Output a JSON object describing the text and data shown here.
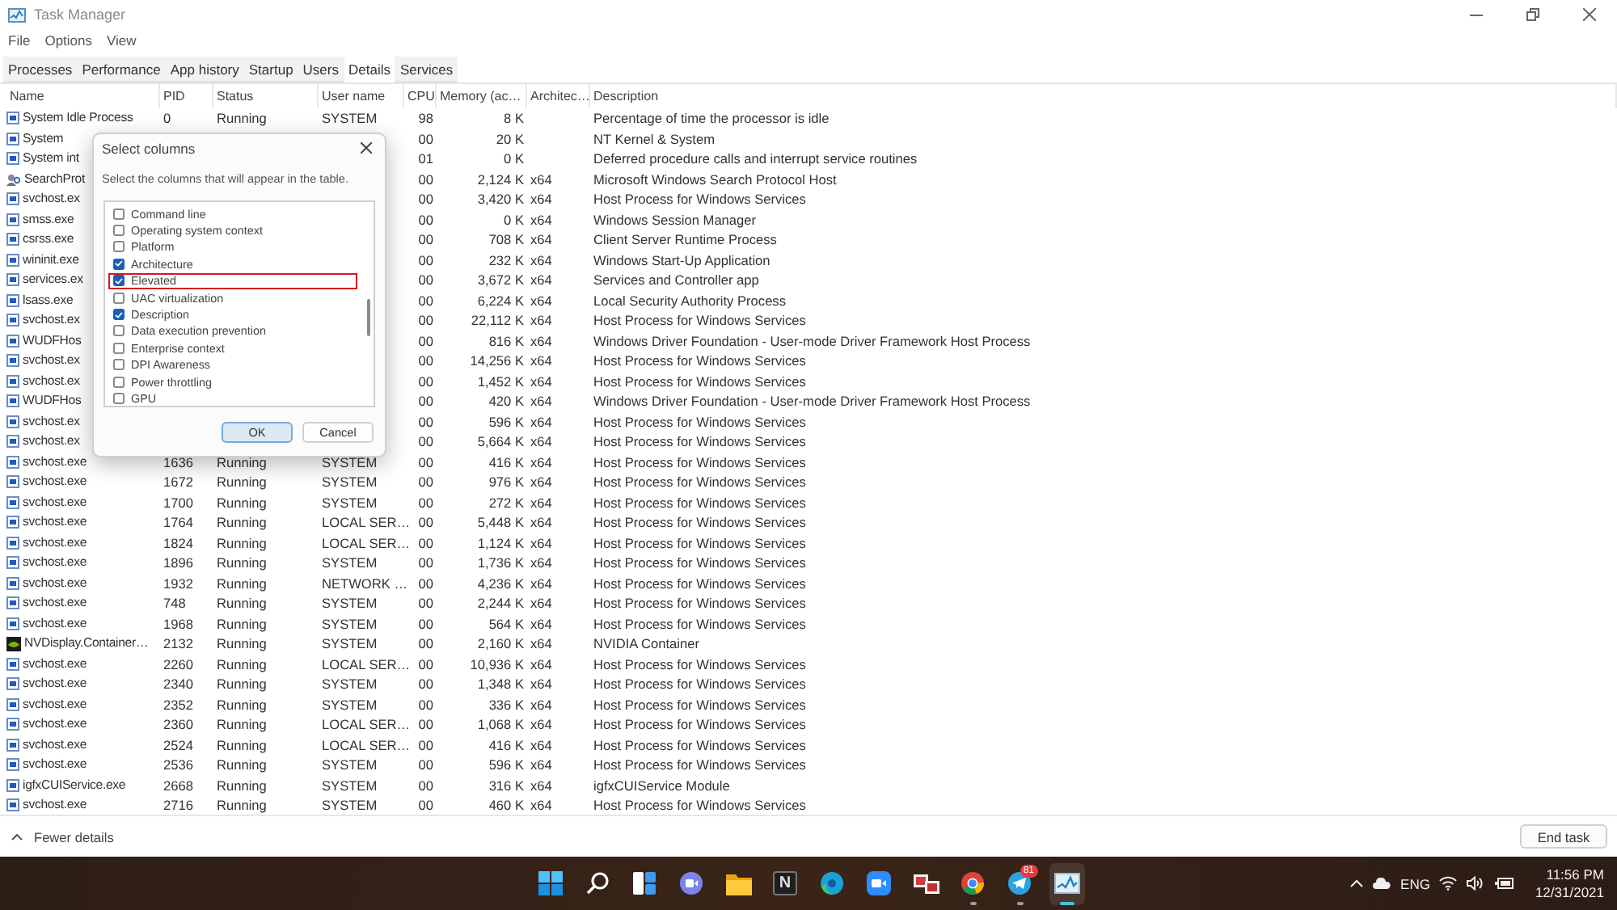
{
  "window": {
    "title": "Task Manager"
  },
  "menu": [
    "File",
    "Options",
    "View"
  ],
  "tabs": [
    {
      "label": "Processes",
      "selected": false
    },
    {
      "label": "Performance",
      "selected": false
    },
    {
      "label": "App history",
      "selected": false
    },
    {
      "label": "Startup",
      "selected": false
    },
    {
      "label": "Users",
      "selected": false
    },
    {
      "label": "Details",
      "selected": true
    },
    {
      "label": "Services",
      "selected": false
    }
  ],
  "table": {
    "columns": [
      "Name",
      "PID",
      "Status",
      "User name",
      "CPU",
      "Memory (ac…",
      "Architec…",
      "Description"
    ],
    "rows": [
      {
        "kind": "app",
        "name": "System Idle Process",
        "pid": "0",
        "status": "Running",
        "user": "SYSTEM",
        "cpu": "98",
        "memory": "8 K",
        "description": "Percentage of time the processor is idle"
      },
      {
        "kind": "app",
        "name": "System",
        "cpu": "00",
        "memory": "20 K",
        "description": "NT Kernel & System"
      },
      {
        "kind": "app",
        "name": "System int",
        "cpu": "01",
        "memory": "0 K",
        "description": "Deferred procedure calls and interrupt service routines"
      },
      {
        "kind": "search",
        "name": "SearchProt",
        "cpu": "00",
        "memory": "2,124 K",
        "arch": "x64",
        "description": "Microsoft Windows Search Protocol Host"
      },
      {
        "kind": "app",
        "name": "svchost.ex",
        "cpu": "00",
        "memory": "3,420 K",
        "arch": "x64",
        "description": "Host Process for Windows Services"
      },
      {
        "kind": "app",
        "name": "smss.exe",
        "cpu": "00",
        "memory": "0 K",
        "arch": "x64",
        "description": "Windows Session Manager"
      },
      {
        "kind": "app",
        "name": "csrss.exe",
        "cpu": "00",
        "memory": "708 K",
        "arch": "x64",
        "description": "Client Server Runtime Process"
      },
      {
        "kind": "app",
        "name": "wininit.exe",
        "cpu": "00",
        "memory": "232 K",
        "arch": "x64",
        "description": "Windows Start-Up Application"
      },
      {
        "kind": "app",
        "name": "services.ex",
        "cpu": "00",
        "memory": "3,672 K",
        "arch": "x64",
        "description": "Services and Controller app"
      },
      {
        "kind": "app",
        "name": "lsass.exe",
        "cpu": "00",
        "memory": "6,224 K",
        "arch": "x64",
        "description": "Local Security Authority Process"
      },
      {
        "kind": "app",
        "name": "svchost.ex",
        "cpu": "00",
        "memory": "22,112 K",
        "arch": "x64",
        "description": "Host Process for Windows Services"
      },
      {
        "kind": "app",
        "name": "WUDFHos",
        "cpu": "00",
        "memory": "816 K",
        "arch": "x64",
        "description": "Windows Driver Foundation - User-mode Driver Framework Host Process"
      },
      {
        "kind": "app",
        "name": "svchost.ex",
        "cpu": "00",
        "memory": "14,256 K",
        "arch": "x64",
        "description": "Host Process for Windows Services"
      },
      {
        "kind": "app",
        "name": "svchost.ex",
        "cpu": "00",
        "memory": "1,452 K",
        "arch": "x64",
        "description": "Host Process for Windows Services"
      },
      {
        "kind": "app",
        "name": "WUDFHos",
        "cpu": "00",
        "memory": "420 K",
        "arch": "x64",
        "description": "Windows Driver Foundation - User-mode Driver Framework Host Process"
      },
      {
        "kind": "app",
        "name": "svchost.ex",
        "cpu": "00",
        "memory": "596 K",
        "arch": "x64",
        "description": "Host Process for Windows Services"
      },
      {
        "kind": "app",
        "name": "svchost.ex",
        "cpu": "00",
        "memory": "5,664 K",
        "arch": "x64",
        "description": "Host Process for Windows Services"
      },
      {
        "kind": "app",
        "name": "svchost.exe",
        "pid": "1636",
        "status": "Running",
        "user": "SYSTEM",
        "cpu": "00",
        "memory": "416 K",
        "arch": "x64",
        "description": "Host Process for Windows Services"
      },
      {
        "kind": "app",
        "name": "svchost.exe",
        "pid": "1672",
        "status": "Running",
        "user": "SYSTEM",
        "cpu": "00",
        "memory": "976 K",
        "arch": "x64",
        "description": "Host Process for Windows Services"
      },
      {
        "kind": "app",
        "name": "svchost.exe",
        "pid": "1700",
        "status": "Running",
        "user": "SYSTEM",
        "cpu": "00",
        "memory": "272 K",
        "arch": "x64",
        "description": "Host Process for Windows Services"
      },
      {
        "kind": "app",
        "name": "svchost.exe",
        "pid": "1764",
        "status": "Running",
        "user": "LOCAL SER…",
        "cpu": "00",
        "memory": "5,448 K",
        "arch": "x64",
        "description": "Host Process for Windows Services"
      },
      {
        "kind": "app",
        "name": "svchost.exe",
        "pid": "1824",
        "status": "Running",
        "user": "LOCAL SER…",
        "cpu": "00",
        "memory": "1,124 K",
        "arch": "x64",
        "description": "Host Process for Windows Services"
      },
      {
        "kind": "app",
        "name": "svchost.exe",
        "pid": "1896",
        "status": "Running",
        "user": "SYSTEM",
        "cpu": "00",
        "memory": "1,736 K",
        "arch": "x64",
        "description": "Host Process for Windows Services"
      },
      {
        "kind": "app",
        "name": "svchost.exe",
        "pid": "1932",
        "status": "Running",
        "user": "NETWORK …",
        "cpu": "00",
        "memory": "4,236 K",
        "arch": "x64",
        "description": "Host Process for Windows Services"
      },
      {
        "kind": "app",
        "name": "svchost.exe",
        "pid": "748",
        "status": "Running",
        "user": "SYSTEM",
        "cpu": "00",
        "memory": "2,244 K",
        "arch": "x64",
        "description": "Host Process for Windows Services"
      },
      {
        "kind": "app",
        "name": "svchost.exe",
        "pid": "1968",
        "status": "Running",
        "user": "SYSTEM",
        "cpu": "00",
        "memory": "564 K",
        "arch": "x64",
        "description": "Host Process for Windows Services"
      },
      {
        "kind": "nvidia",
        "name": "NVDisplay.Container…",
        "pid": "2132",
        "status": "Running",
        "user": "SYSTEM",
        "cpu": "00",
        "memory": "2,160 K",
        "arch": "x64",
        "description": "NVIDIA Container"
      },
      {
        "kind": "app",
        "name": "svchost.exe",
        "pid": "2260",
        "status": "Running",
        "user": "LOCAL SER…",
        "cpu": "00",
        "memory": "10,936 K",
        "arch": "x64",
        "description": "Host Process for Windows Services"
      },
      {
        "kind": "app",
        "name": "svchost.exe",
        "pid": "2340",
        "status": "Running",
        "user": "SYSTEM",
        "cpu": "00",
        "memory": "1,348 K",
        "arch": "x64",
        "description": "Host Process for Windows Services"
      },
      {
        "kind": "app",
        "name": "svchost.exe",
        "pid": "2352",
        "status": "Running",
        "user": "SYSTEM",
        "cpu": "00",
        "memory": "336 K",
        "arch": "x64",
        "description": "Host Process for Windows Services"
      },
      {
        "kind": "app",
        "name": "svchost.exe",
        "pid": "2360",
        "status": "Running",
        "user": "LOCAL SER…",
        "cpu": "00",
        "memory": "1,068 K",
        "arch": "x64",
        "description": "Host Process for Windows Services"
      },
      {
        "kind": "app",
        "name": "svchost.exe",
        "pid": "2524",
        "status": "Running",
        "user": "LOCAL SER…",
        "cpu": "00",
        "memory": "416 K",
        "arch": "x64",
        "description": "Host Process for Windows Services"
      },
      {
        "kind": "app",
        "name": "svchost.exe",
        "pid": "2536",
        "status": "Running",
        "user": "SYSTEM",
        "cpu": "00",
        "memory": "596 K",
        "arch": "x64",
        "description": "Host Process for Windows Services"
      },
      {
        "kind": "app",
        "name": "igfxCUIService.exe",
        "pid": "2668",
        "status": "Running",
        "user": "SYSTEM",
        "cpu": "00",
        "memory": "316 K",
        "arch": "x64",
        "description": "igfxCUIService Module"
      },
      {
        "kind": "app",
        "name": "svchost.exe",
        "pid": "2716",
        "status": "Running",
        "user": "SYSTEM",
        "cpu": "00",
        "memory": "460 K",
        "arch": "x64",
        "description": "Host Process for Windows Services"
      }
    ]
  },
  "dialog": {
    "title": "Select columns",
    "prompt": "Select the columns that will appear in the table.",
    "options": [
      {
        "label": "Command line",
        "checked": false,
        "highlighted": false
      },
      {
        "label": "Operating system context",
        "checked": false,
        "highlighted": false
      },
      {
        "label": "Platform",
        "checked": false,
        "highlighted": false
      },
      {
        "label": "Architecture",
        "checked": true,
        "highlighted": false
      },
      {
        "label": "Elevated",
        "checked": true,
        "highlighted": true
      },
      {
        "label": "UAC virtualization",
        "checked": false,
        "highlighted": false
      },
      {
        "label": "Description",
        "checked": true,
        "highlighted": false
      },
      {
        "label": "Data execution prevention",
        "checked": false,
        "highlighted": false
      },
      {
        "label": "Enterprise context",
        "checked": false,
        "highlighted": false
      },
      {
        "label": "DPI Awareness",
        "checked": false,
        "highlighted": false
      },
      {
        "label": "Power throttling",
        "checked": false,
        "highlighted": false
      },
      {
        "label": "GPU",
        "checked": false,
        "highlighted": false
      }
    ],
    "buttons": [
      {
        "label": "OK",
        "primary": true
      },
      {
        "label": "Cancel",
        "primary": false
      }
    ]
  },
  "footer": {
    "toggle": "Fewer details",
    "button": "End task"
  },
  "taskbar": {
    "pins": [
      {
        "kind": "start",
        "open": false,
        "active": false
      },
      {
        "kind": "search",
        "open": false,
        "active": false
      },
      {
        "kind": "widgets",
        "open": false,
        "active": false
      },
      {
        "kind": "chat",
        "open": false,
        "active": false
      },
      {
        "kind": "folder",
        "open": false,
        "active": false
      },
      {
        "kind": "letter",
        "label": "N",
        "open": false,
        "active": false
      },
      {
        "kind": "edge",
        "open": false,
        "active": false
      },
      {
        "kind": "video",
        "open": false,
        "active": false
      },
      {
        "kind": "gallery",
        "open": false,
        "active": false
      },
      {
        "kind": "chrome",
        "open": true,
        "active": false
      },
      {
        "kind": "telegram",
        "badge": "81",
        "open": true,
        "active": false
      },
      {
        "kind": "monitor",
        "open": true,
        "active": true
      }
    ],
    "tray": {
      "language": "ENG",
      "time": "11:56 PM",
      "date": "12/31/2021"
    }
  }
}
